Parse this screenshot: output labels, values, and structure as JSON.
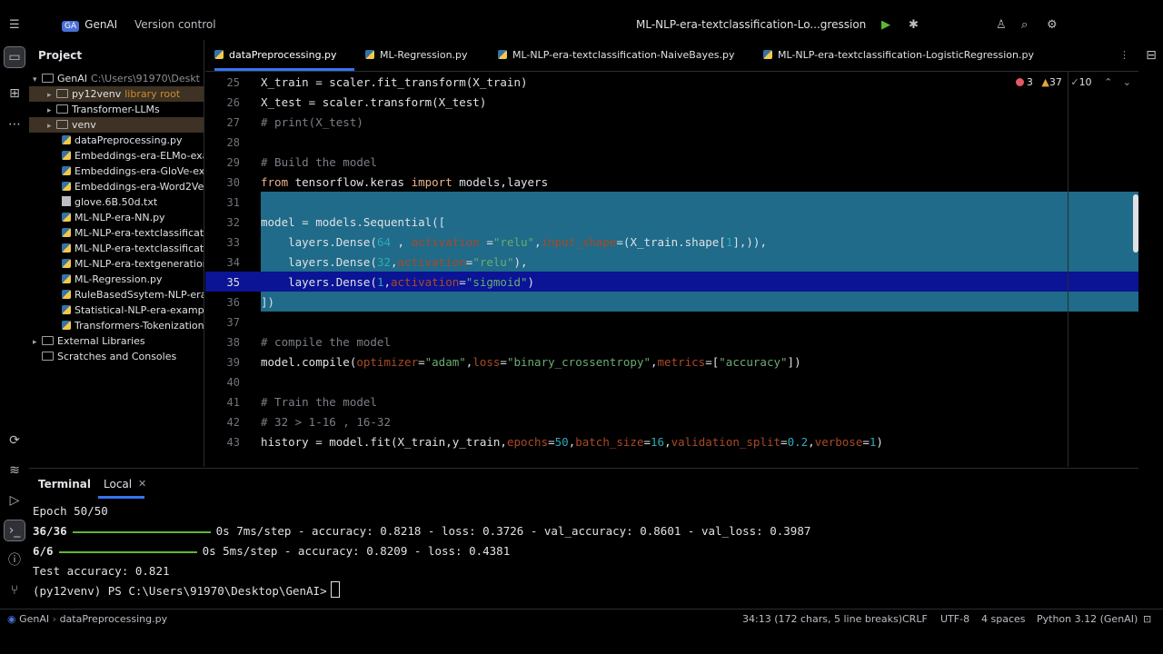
{
  "titlebar": {
    "badge": "GA",
    "project": "GenAI",
    "vcs": "Version control",
    "run_config": "ML-NLP-era-textclassification-Lo...gression"
  },
  "project_panel": {
    "title": "Project",
    "items": [
      {
        "name": "GenAI",
        "extra": "C:\\Users\\91970\\Deskt"
      },
      {
        "name": "py12venv",
        "extra": "library root"
      },
      {
        "name": "Transformer-LLMs"
      },
      {
        "name": "venv"
      },
      {
        "name": "dataPreprocessing.py"
      },
      {
        "name": "Embeddings-era-ELMo-exa"
      },
      {
        "name": "Embeddings-era-GloVe-exa"
      },
      {
        "name": "Embeddings-era-Word2Vec"
      },
      {
        "name": "glove.6B.50d.txt"
      },
      {
        "name": "ML-NLP-era-NN.py"
      },
      {
        "name": "ML-NLP-era-textclassificati"
      },
      {
        "name": "ML-NLP-era-textclassificat"
      },
      {
        "name": "ML-NLP-era-textgeneration"
      },
      {
        "name": "ML-Regression.py"
      },
      {
        "name": "RuleBasedSsytem-NLP-era"
      },
      {
        "name": "Statistical-NLP-era-exampl"
      },
      {
        "name": "Transformers-Tokenization"
      },
      {
        "name": "External Libraries"
      },
      {
        "name": "Scratches and Consoles"
      }
    ]
  },
  "tabs": [
    "dataPreprocessing.py",
    "ML-Regression.py",
    "ML-NLP-era-textclassification-NaiveBayes.py",
    "ML-NLP-era-textclassification-LogisticRegression.py"
  ],
  "inspections": {
    "errors": "3",
    "warnings": "37",
    "weak": "10"
  },
  "code": {
    "line_numbers": [
      "25",
      "26",
      "27",
      "28",
      "29",
      "30",
      "31",
      "32",
      "33",
      "34",
      "35",
      "36",
      "37",
      "38",
      "39",
      "40",
      "41",
      "42",
      "43"
    ]
  },
  "terminal": {
    "title": "Terminal",
    "tab": "Local",
    "lines": {
      "l1": "Epoch 50/50",
      "l2a": "36/36",
      "l2b": "0s 7ms/step - accuracy: 0.8218 - loss: 0.3726 - val_accuracy: 0.8601 - val_loss: 0.3987",
      "l3a": "6/6",
      "l3b": "0s 5ms/step - accuracy: 0.8209 - loss: 0.4381",
      "l4": "Test accuracy: 0.821",
      "l5": "(py12venv) PS C:\\Users\\91970\\Desktop\\GenAI>"
    }
  },
  "statusbar": {
    "crumb1": "GenAI",
    "crumb2": "dataPreprocessing.py",
    "position": "34:13 (172 chars, 5 line breaks)",
    "line_sep": "CRLF",
    "encoding": "UTF-8",
    "indent": "4 spaces",
    "interpreter": "Python 3.12 (GenAI)"
  }
}
